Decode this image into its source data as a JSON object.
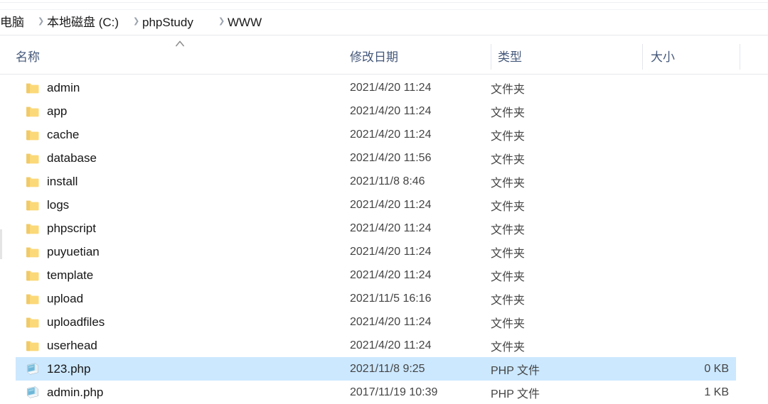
{
  "window": {
    "app": "file-explorer",
    "selection_color": "#cce8ff",
    "header_text_color": "#44587a",
    "folder_icon_color": "#ffd76e",
    "php_icon_color": "#5ba7c9"
  },
  "breadcrumb": {
    "separator": "❯",
    "items": [
      {
        "label": "电脑"
      },
      {
        "label": "本地磁盘 (C:)"
      },
      {
        "label": "phpStudy"
      },
      {
        "label": "WWW"
      }
    ]
  },
  "columns": {
    "sort_indicator_icon": "chevron-up-icon",
    "sorted_by": "名称",
    "sort_direction": "ascending",
    "headers": [
      {
        "label": "名称",
        "key": "name"
      },
      {
        "label": "修改日期",
        "key": "date"
      },
      {
        "label": "类型",
        "key": "type"
      },
      {
        "label": "大小",
        "key": "size"
      }
    ]
  },
  "files": [
    {
      "name": "admin",
      "date": "2021/4/20 11:24",
      "type": "文件夹",
      "size": "",
      "icon": "folder-icon",
      "selected": false
    },
    {
      "name": "app",
      "date": "2021/4/20 11:24",
      "type": "文件夹",
      "size": "",
      "icon": "folder-icon",
      "selected": false
    },
    {
      "name": "cache",
      "date": "2021/4/20 11:24",
      "type": "文件夹",
      "size": "",
      "icon": "folder-icon",
      "selected": false
    },
    {
      "name": "database",
      "date": "2021/4/20 11:56",
      "type": "文件夹",
      "size": "",
      "icon": "folder-icon",
      "selected": false
    },
    {
      "name": "install",
      "date": "2021/11/8 8:46",
      "type": "文件夹",
      "size": "",
      "icon": "folder-icon",
      "selected": false
    },
    {
      "name": "logs",
      "date": "2021/4/20 11:24",
      "type": "文件夹",
      "size": "",
      "icon": "folder-icon",
      "selected": false
    },
    {
      "name": "phpscript",
      "date": "2021/4/20 11:24",
      "type": "文件夹",
      "size": "",
      "icon": "folder-icon",
      "selected": false
    },
    {
      "name": "puyuetian",
      "date": "2021/4/20 11:24",
      "type": "文件夹",
      "size": "",
      "icon": "folder-icon",
      "selected": false
    },
    {
      "name": "template",
      "date": "2021/4/20 11:24",
      "type": "文件夹",
      "size": "",
      "icon": "folder-icon",
      "selected": false
    },
    {
      "name": "upload",
      "date": "2021/11/5 16:16",
      "type": "文件夹",
      "size": "",
      "icon": "folder-icon",
      "selected": false
    },
    {
      "name": "uploadfiles",
      "date": "2021/4/20 11:24",
      "type": "文件夹",
      "size": "",
      "icon": "folder-icon",
      "selected": false
    },
    {
      "name": "userhead",
      "date": "2021/4/20 11:24",
      "type": "文件夹",
      "size": "",
      "icon": "folder-icon",
      "selected": false
    },
    {
      "name": "123.php",
      "date": "2021/11/8 9:25",
      "type": "PHP 文件",
      "size": "0 KB",
      "icon": "php-file-icon",
      "selected": true
    },
    {
      "name": "admin.php",
      "date": "2017/11/19 10:39",
      "type": "PHP 文件",
      "size": "1 KB",
      "icon": "php-file-icon",
      "selected": false
    }
  ]
}
